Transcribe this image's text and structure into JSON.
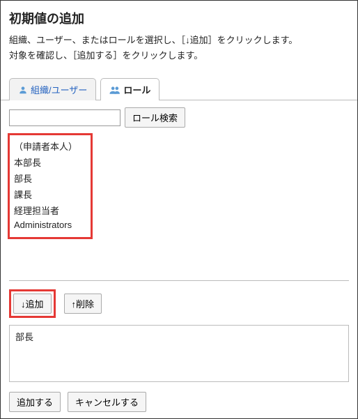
{
  "header": {
    "title": "初期値の追加",
    "desc_line1": "組織、ユーザー、またはロールを選択し、［↓追加］をクリックします。",
    "desc_line2": "対象を確認し、［追加する］をクリックします。"
  },
  "tabs": {
    "org_user": "組織/ユーザー",
    "role": "ロール"
  },
  "search": {
    "value": "",
    "button": "ロール検索"
  },
  "roles": [
    "（申請者本人）",
    "本部長",
    "部長",
    "課長",
    "経理担当者",
    "Administrators"
  ],
  "actions": {
    "add": "↓追加",
    "remove": "↑削除"
  },
  "selected": {
    "items": [
      "部長"
    ]
  },
  "footer": {
    "submit": "追加する",
    "cancel": "キャンセルする"
  }
}
